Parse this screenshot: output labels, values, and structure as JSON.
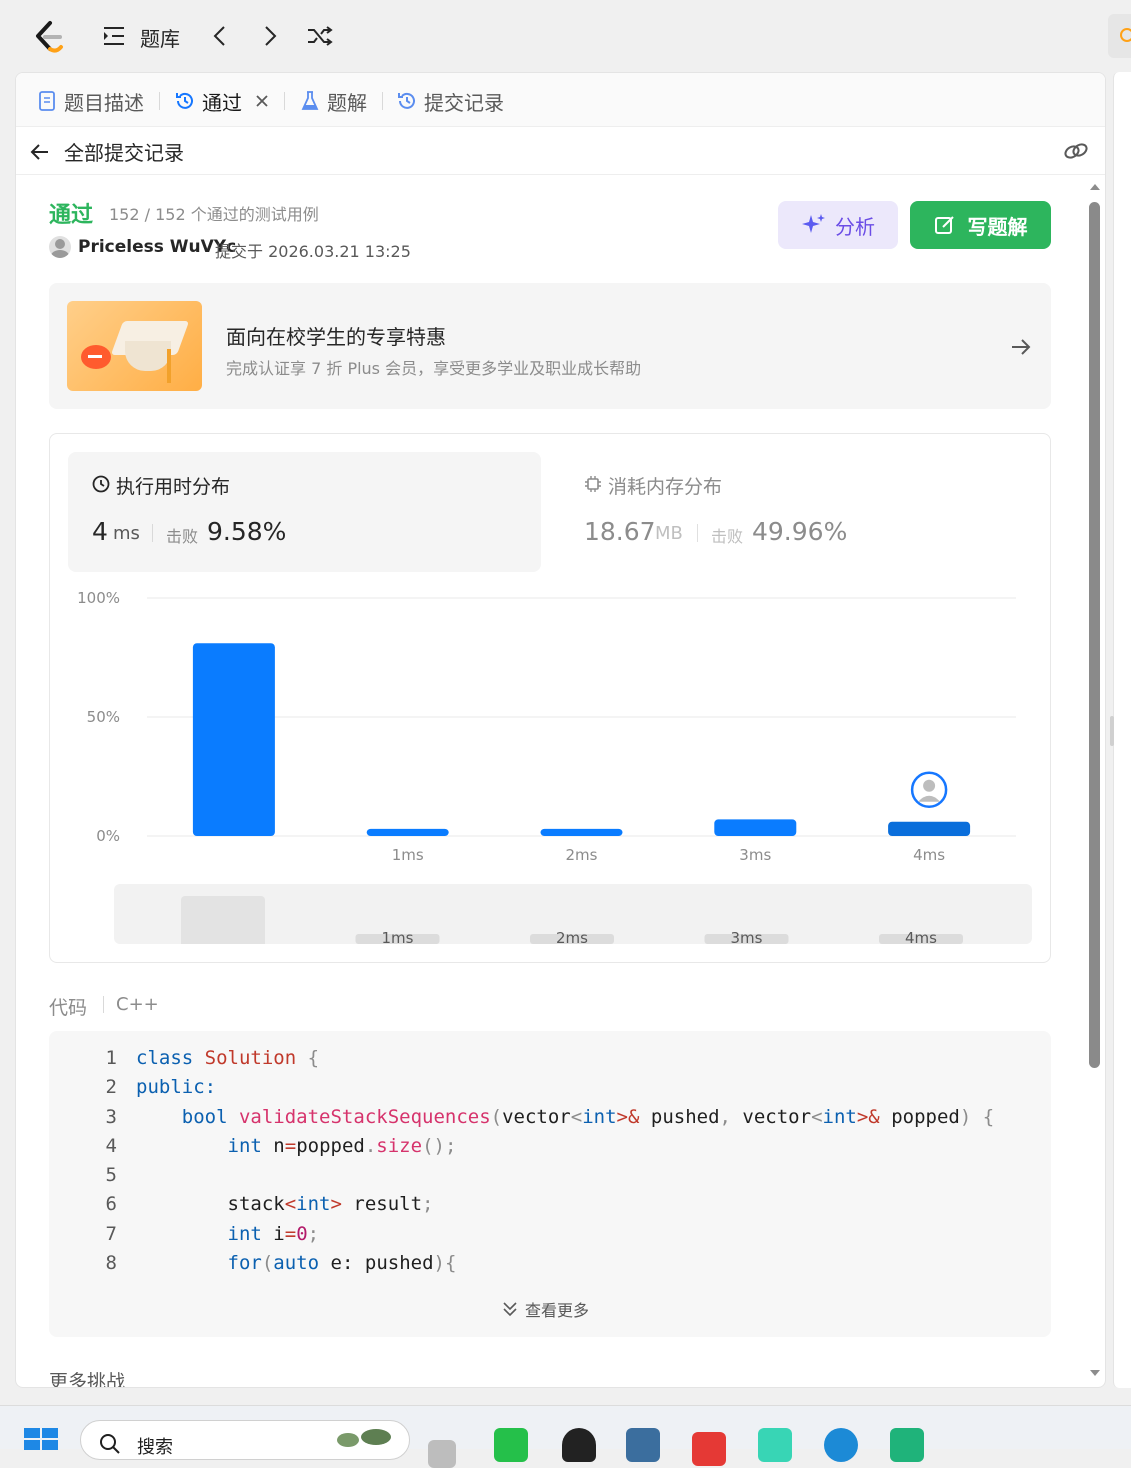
{
  "topbar": {
    "title": "题库"
  },
  "tabs": [
    {
      "label": "题目描述"
    },
    {
      "label": "通过"
    },
    {
      "label": "题解"
    },
    {
      "label": "提交记录"
    }
  ],
  "subbar": {
    "back_label": "全部提交记录"
  },
  "result": {
    "status": "通过",
    "cases": "152 / 152 个通过的测试用例",
    "user": "Priceless WuVYc",
    "submitted": "提交于 2026.03.21 13:25",
    "analyze_label": "分析",
    "write_label": "写题解"
  },
  "promo": {
    "title": "面向在校学生的专享特惠",
    "subtitle": "完成认证享 7 折 Plus 会员，享受更多学业及职业成长帮助"
  },
  "stats": {
    "runtime": {
      "title": "执行用时分布",
      "value": "4",
      "unit": "ms",
      "beat_label": "击败",
      "beat": "9.58%"
    },
    "memory": {
      "title": "消耗内存分布",
      "value": "18.67",
      "unit": "MB",
      "beat_label": "击败",
      "beat": "49.96%"
    }
  },
  "chart_data": {
    "type": "bar",
    "categories": [
      "",
      "1ms",
      "2ms",
      "3ms",
      "4ms"
    ],
    "values": [
      81,
      3,
      3,
      7,
      6
    ],
    "ylim": [
      0,
      100
    ],
    "yticks": [
      "100%",
      "50%",
      "0%"
    ],
    "highlight_index": 4,
    "colors": {
      "bar": "#0a7cff",
      "highlight": "#0a6edb",
      "grid": "#e8e8e8"
    },
    "overview_labels": [
      "1ms",
      "2ms",
      "3ms",
      "4ms"
    ]
  },
  "code": {
    "label": "代码",
    "lang": "C++",
    "lines": [
      {
        "n": "1"
      },
      {
        "n": "2"
      },
      {
        "n": "3"
      },
      {
        "n": "4"
      },
      {
        "n": "5"
      },
      {
        "n": "6"
      },
      {
        "n": "7"
      },
      {
        "n": "8"
      }
    ],
    "tokens": {
      "l1": [
        "class",
        "Solution",
        "{"
      ],
      "l2": [
        "public",
        ":"
      ],
      "l3": [
        "bool",
        "validateStackSequences",
        "(",
        "vector",
        "<",
        "int",
        ">&",
        "pushed",
        ",",
        "vector",
        "<",
        "int",
        ">&",
        "popped",
        ")",
        "{"
      ],
      "l4": [
        "int",
        "n",
        "=",
        "popped",
        ".",
        "size",
        "();"
      ],
      "l6": [
        "stack",
        "<",
        "int",
        ">",
        "result",
        ";"
      ],
      "l7": [
        "int",
        "i",
        "=",
        "0",
        ";"
      ],
      "l8": [
        "for",
        "(",
        "auto",
        "e",
        ":",
        "pushed",
        "){"
      ]
    },
    "more_label": "查看更多"
  },
  "more_challenges": "更多挑战",
  "taskbar": {
    "search_placeholder": "搜索"
  }
}
